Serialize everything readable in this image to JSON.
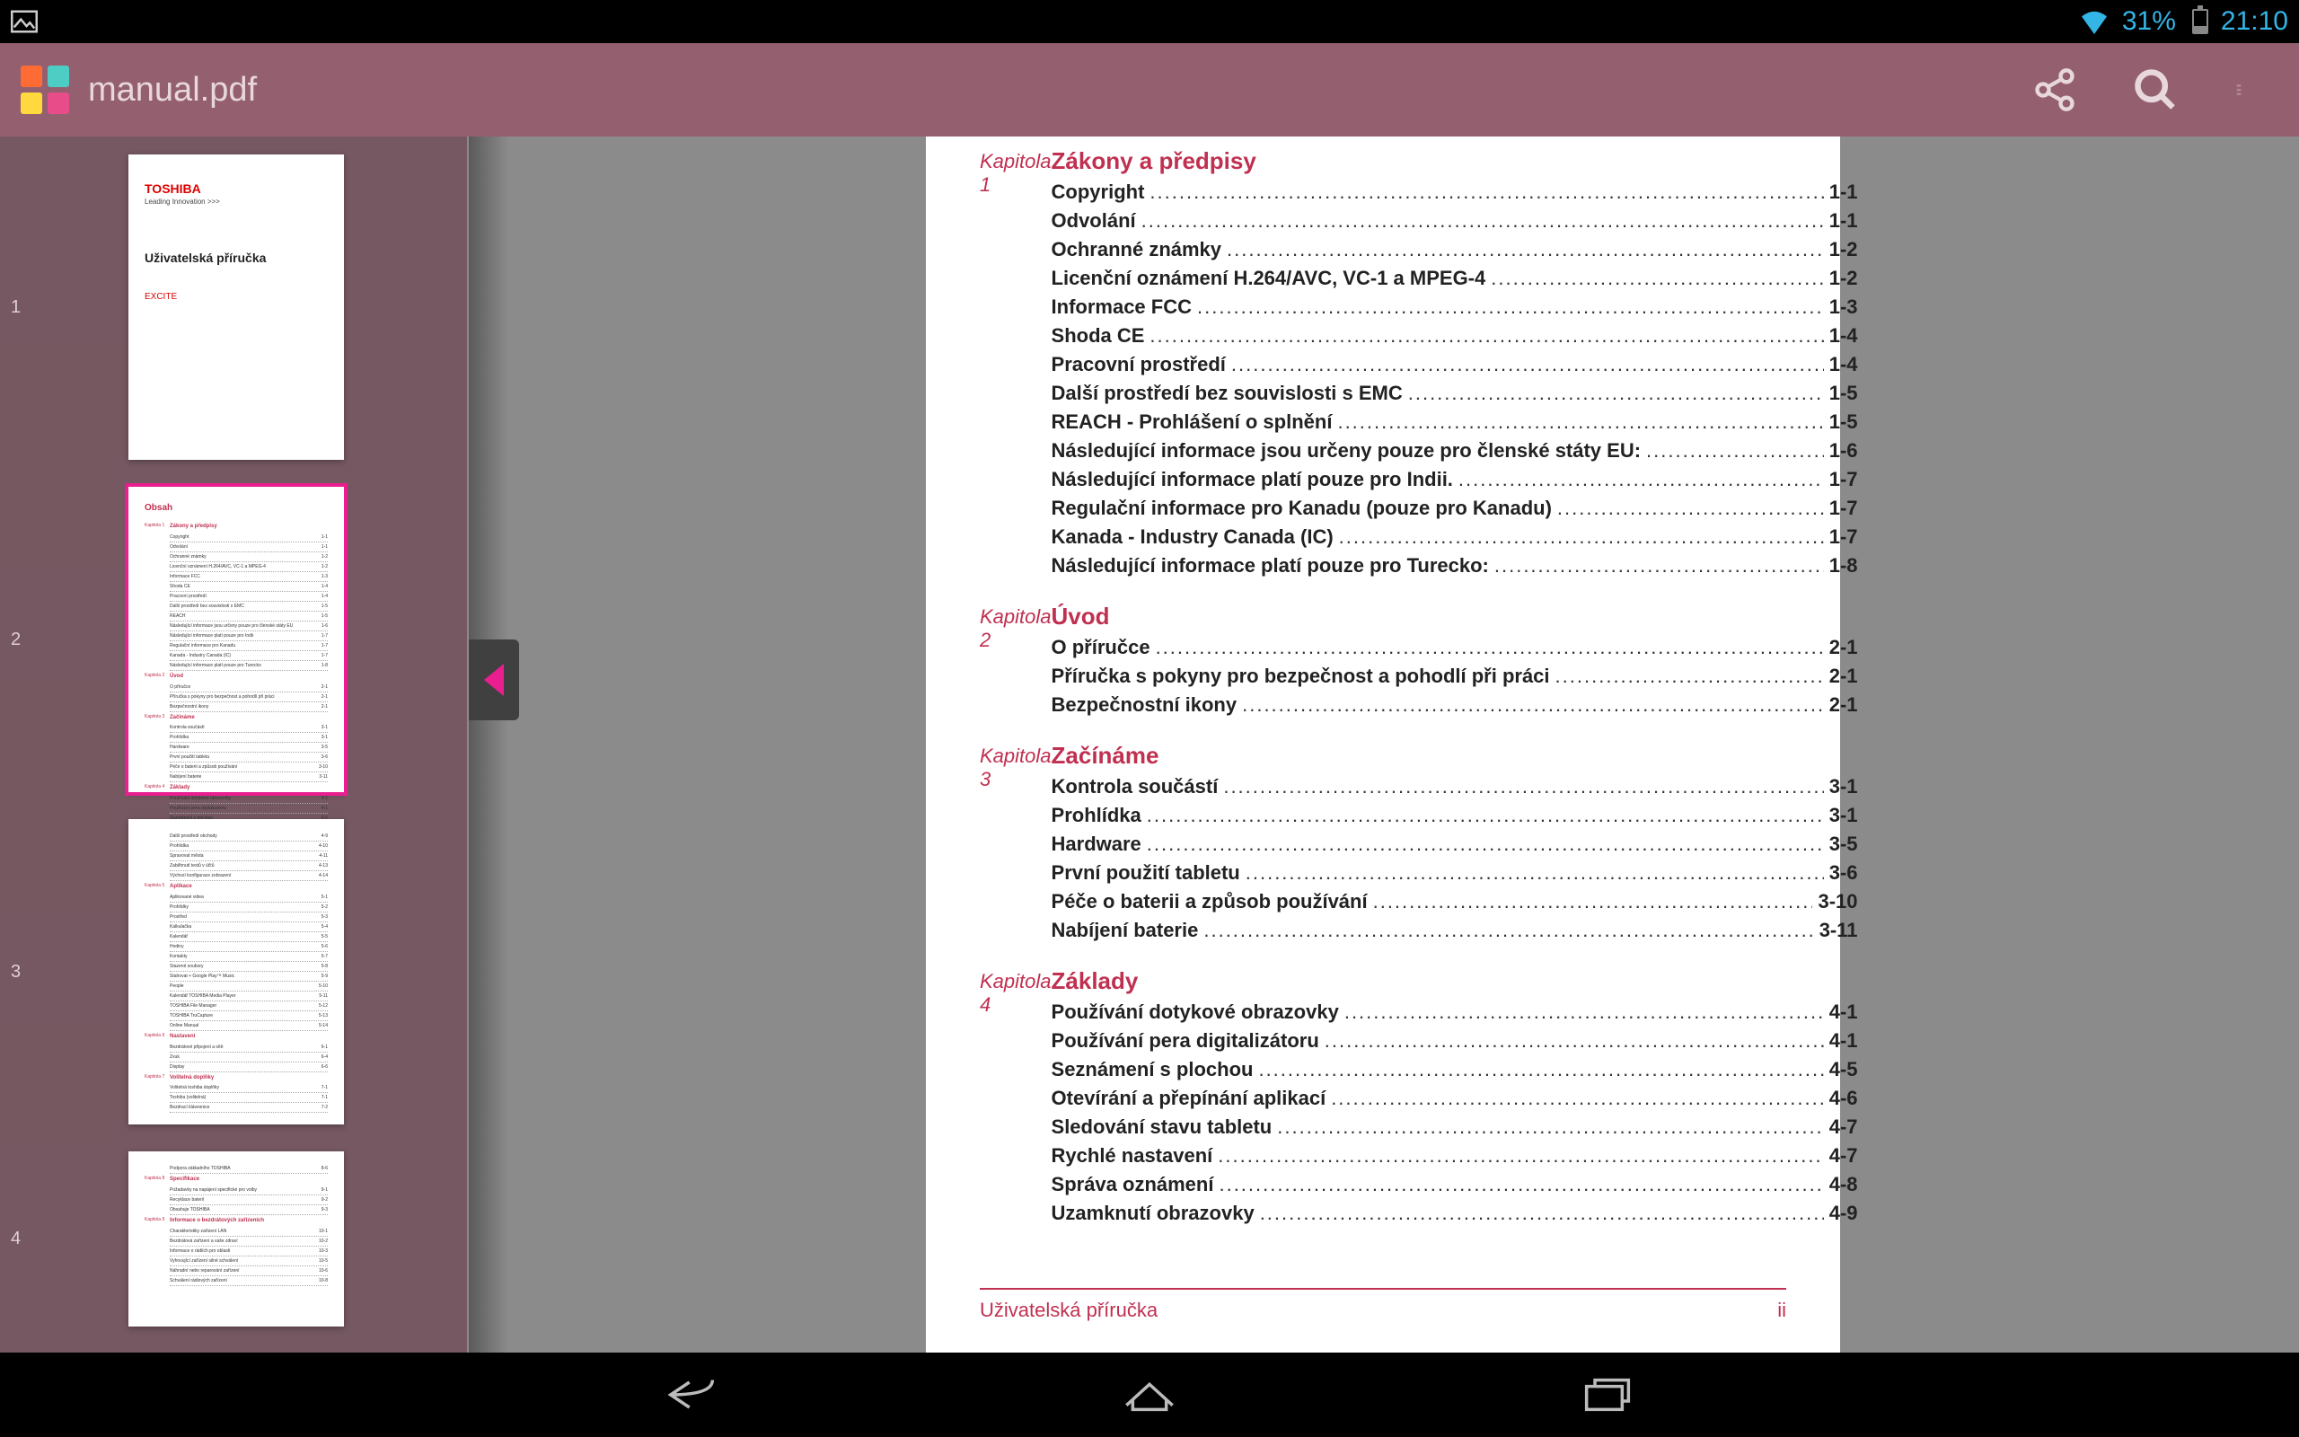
{
  "status": {
    "battery_pct": "31%",
    "time": "21:10"
  },
  "app": {
    "title": "manual.pdf"
  },
  "thumbnails": {
    "page1": {
      "brand": "TOSHIBA",
      "brand_sub": "Leading Innovation >>>",
      "title": "Uživatelská příručka",
      "model": "EXCITE"
    }
  },
  "toc": {
    "chapters": [
      {
        "label": "Kapitola 1",
        "title": "Zákony a předpisy",
        "items": [
          {
            "t": "Copyright",
            "p": "1-1"
          },
          {
            "t": "Odvolání",
            "p": "1-1"
          },
          {
            "t": "Ochranné známky",
            "p": "1-2"
          },
          {
            "t": "Licenční oznámení H.264/AVC, VC-1 a MPEG-4",
            "p": "1-2"
          },
          {
            "t": "Informace FCC",
            "p": "1-3"
          },
          {
            "t": "Shoda CE",
            "p": "1-4"
          },
          {
            "t": "Pracovní prostředí",
            "p": "1-4"
          },
          {
            "t": "Další prostředí bez souvislosti s EMC",
            "p": "1-5"
          },
          {
            "t": "REACH - Prohlášení o splnění",
            "p": "1-5"
          },
          {
            "t": "Následující informace jsou určeny pouze pro členské státy EU:",
            "p": "1-6"
          },
          {
            "t": "Následující informace platí pouze pro Indii.",
            "p": "1-7"
          },
          {
            "t": "Regulační informace pro Kanadu (pouze pro Kanadu)",
            "p": "1-7"
          },
          {
            "t": "Kanada - Industry Canada (IC)",
            "p": "1-7"
          },
          {
            "t": "Následující informace platí pouze pro Turecko:",
            "p": "1-8"
          }
        ]
      },
      {
        "label": "Kapitola 2",
        "title": "Úvod",
        "items": [
          {
            "t": "O příručce",
            "p": "2-1"
          },
          {
            "t": "Příručka s pokyny pro bezpečnost a pohodlí při práci",
            "p": "2-1"
          },
          {
            "t": "Bezpečnostní ikony",
            "p": "2-1"
          }
        ]
      },
      {
        "label": "Kapitola 3",
        "title": "Začínáme",
        "items": [
          {
            "t": "Kontrola součástí",
            "p": "3-1"
          },
          {
            "t": "Prohlídka",
            "p": "3-1"
          },
          {
            "t": "Hardware",
            "p": "3-5"
          },
          {
            "t": "První použití tabletu",
            "p": "3-6"
          },
          {
            "t": "Péče o baterii a způsob používání",
            "p": "3-10"
          },
          {
            "t": "Nabíjení baterie",
            "p": "3-11"
          }
        ]
      },
      {
        "label": "Kapitola 4",
        "title": "Základy",
        "items": [
          {
            "t": "Používání dotykové obrazovky",
            "p": "4-1"
          },
          {
            "t": "Používání pera digitalizátoru",
            "p": "4-1"
          },
          {
            "t": "Seznámení s plochou",
            "p": "4-5"
          },
          {
            "t": "Otevírání a přepínání aplikací",
            "p": "4-6"
          },
          {
            "t": "Sledování stavu tabletu",
            "p": "4-7"
          },
          {
            "t": "Rychlé nastavení",
            "p": "4-7"
          },
          {
            "t": "Správa oznámení",
            "p": "4-8"
          },
          {
            "t": "Uzamknutí obrazovky",
            "p": "4-9"
          }
        ]
      }
    ]
  },
  "footer": {
    "left": "Uživatelská příručka",
    "right": "ii"
  }
}
